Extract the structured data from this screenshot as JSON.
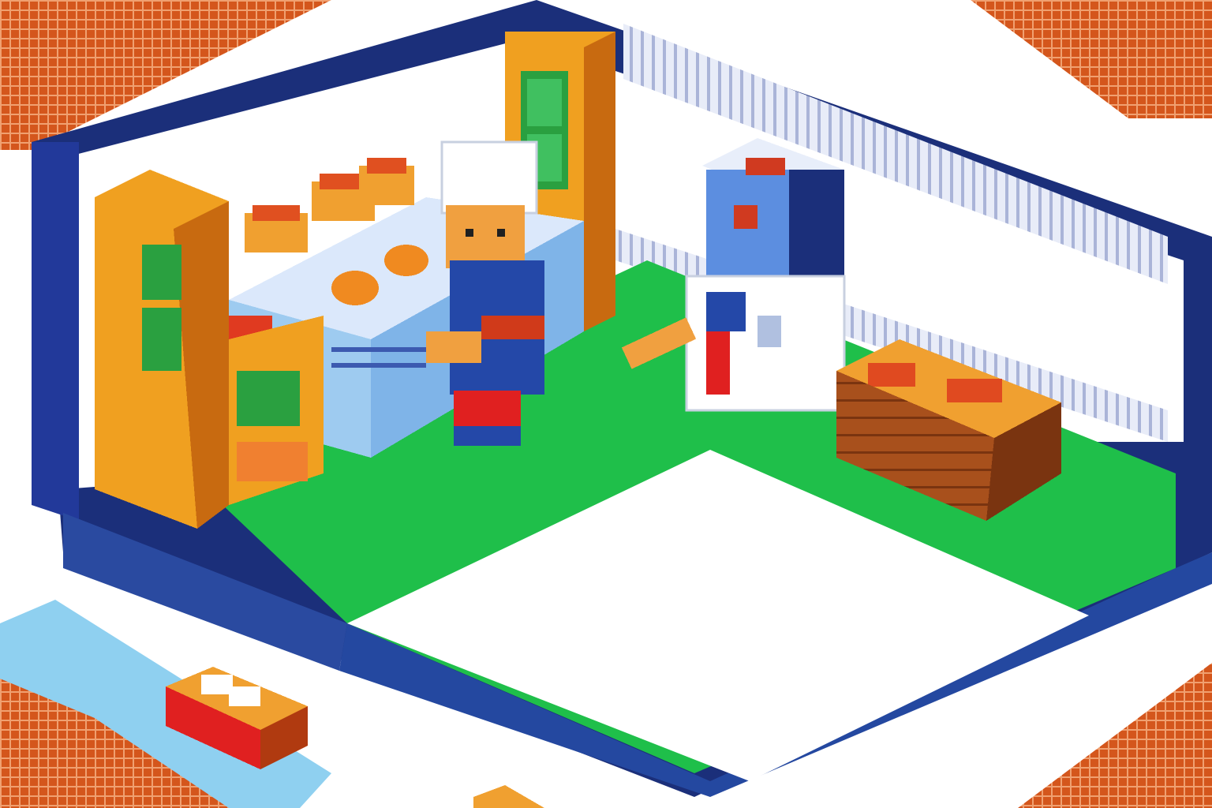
{
  "scene": {
    "type": "isometric-pixel-art",
    "setting": "shop-interior",
    "visible_text": []
  },
  "colors": {
    "brick_orange": "#e05a1a",
    "wall_navy": "#1b2f7a",
    "wall_blue": "#2a4aa0",
    "floor_green": "#1fbf4a",
    "floor_white": "#ffffff",
    "shelf_orange": "#f0a020",
    "shelf_dark": "#c86a10",
    "counter_blue": "#9ecbf0",
    "crate_brown": "#a84a18",
    "robot_blue": "#5c8ee0",
    "player_blue": "#2448a8",
    "player_red": "#e02020",
    "skin": "#f0a040",
    "pale_blue": "#8fd0f0"
  },
  "objects": [
    {
      "name": "shopkeeper"
    },
    {
      "name": "robot-vendor"
    },
    {
      "name": "left-shelf-unit"
    },
    {
      "name": "back-shelf-unit"
    },
    {
      "name": "display-counter"
    },
    {
      "name": "produce-crate"
    },
    {
      "name": "floor-item"
    },
    {
      "name": "outdoor-crate"
    }
  ]
}
